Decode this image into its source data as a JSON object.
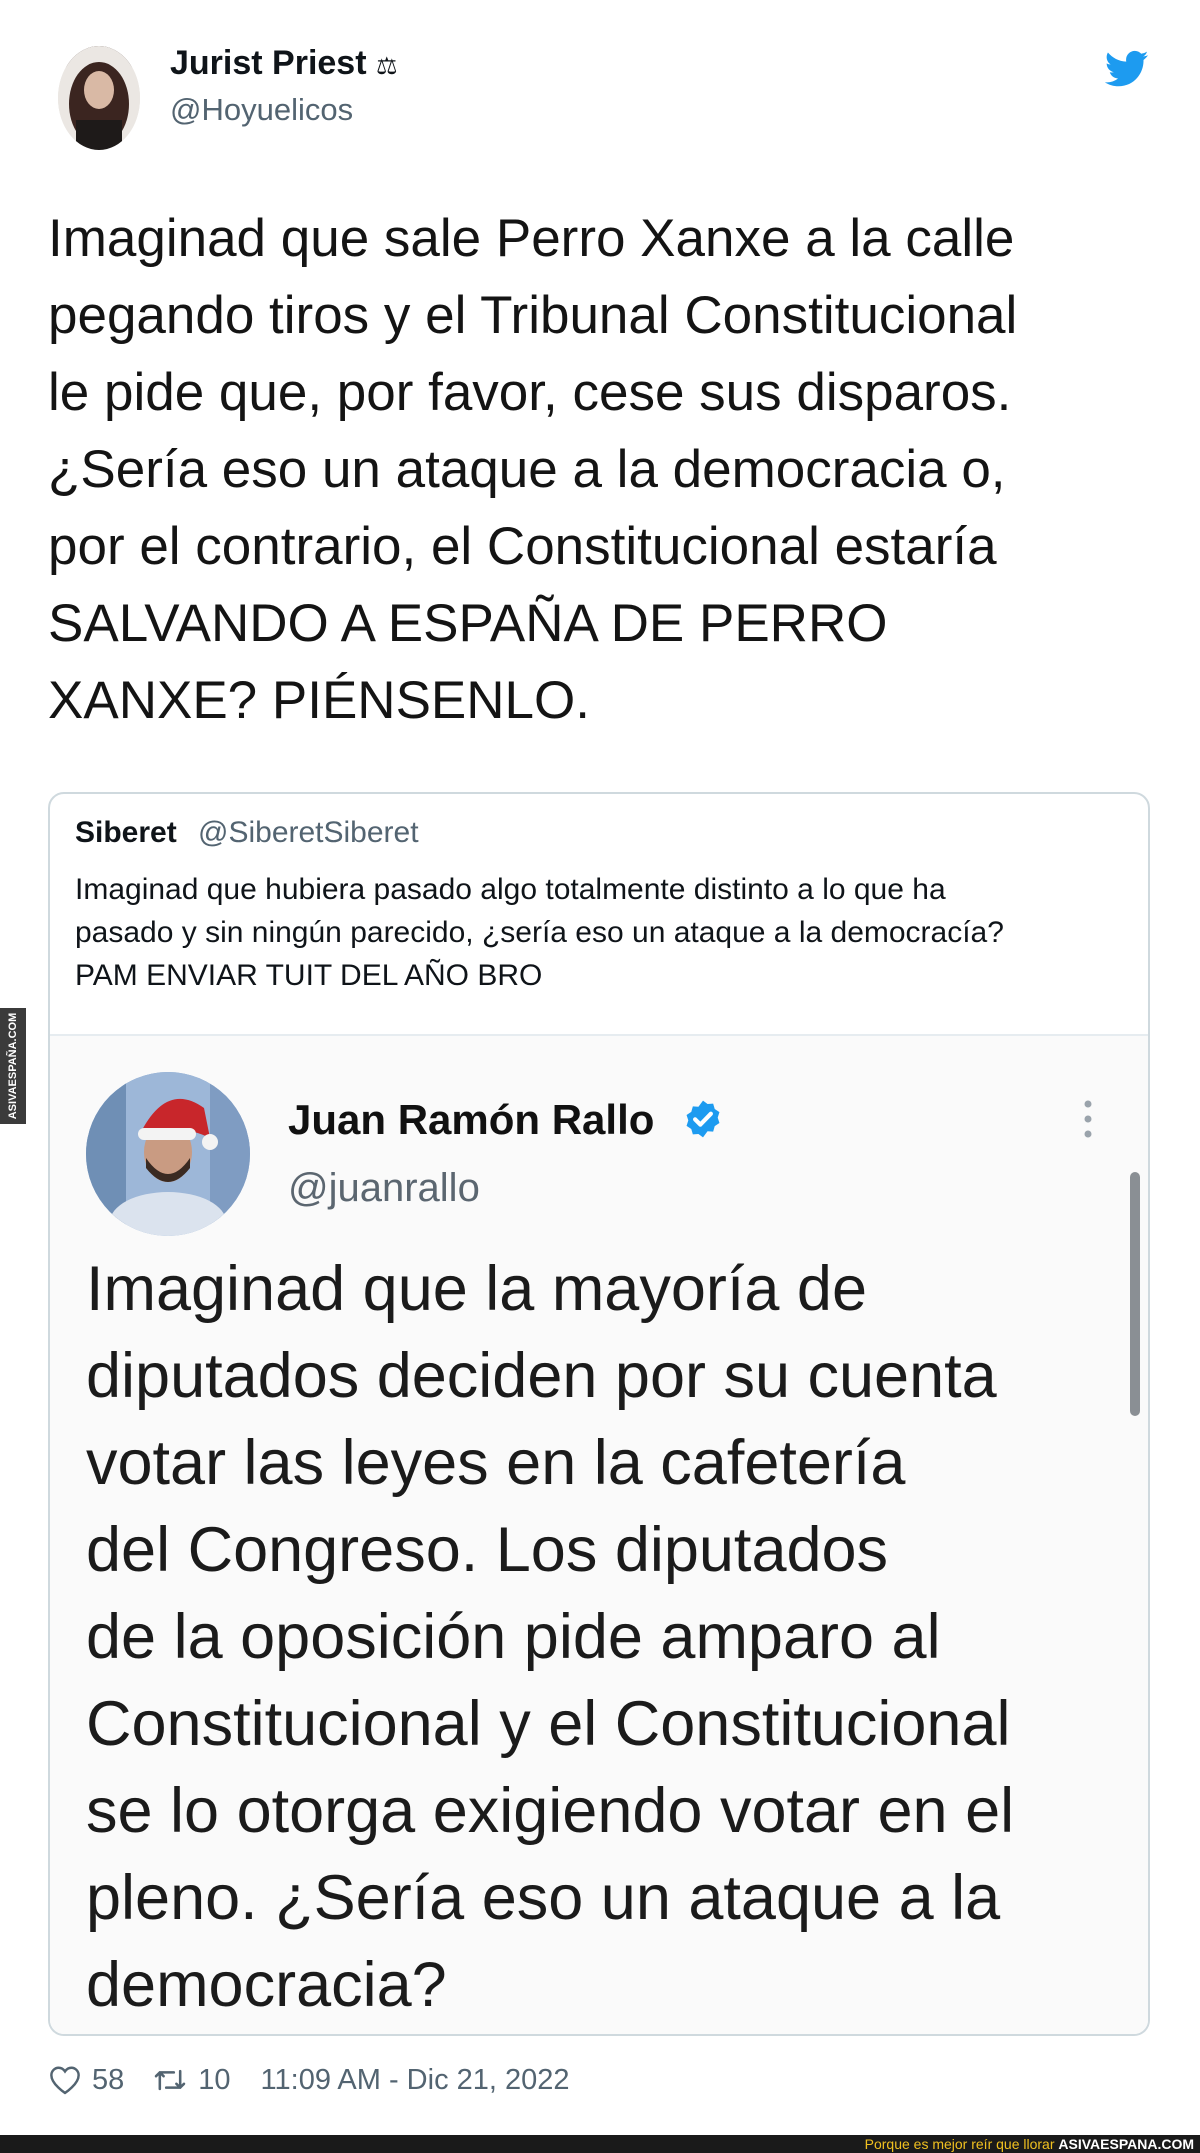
{
  "tweet": {
    "author_name": "Jurist Priest",
    "author_badge": "⚖",
    "author_handle": "@Hoyuelicos",
    "text": "Imaginad que sale Perro Xanxe a la calle\npegando tiros y el Tribunal Constitucional\nle pide que, por favor, cese sus disparos.\n¿Sería eso un ataque a la democracia o,\npor el contrario, el Constitucional estaría\nSALVANDO A ESPAÑA DE PERRO\nXANXE? PIÉNSENLO.",
    "brand_color": "#1d9bf0"
  },
  "quoted": {
    "author_name": "Siberet",
    "author_handle": "@SiberetSiberet",
    "text": "Imaginad que hubiera pasado algo totalmente distinto a lo que ha\npasado y sin ningún parecido, ¿sería eso un ataque a la democracía?\nPAM ENVIAR TUIT DEL AÑO BRO"
  },
  "embedded": {
    "author_name": "Juan Ramón Rallo",
    "author_handle": "@juanrallo",
    "text": "Imaginad que la mayoría de\ndiputados deciden por su cuenta\nvotar las leyes en la cafetería\ndel Congreso. Los diputados\nde la oposición pide  amparo al\nConstitucional y el Constitucional\nse lo otorga exigiendo votar en el\npleno. ¿Sería eso un ataque a la\ndemocracia?"
  },
  "footer": {
    "likes": "58",
    "retweets": "10",
    "timestamp": "11:09 AM - Dic 21, 2022"
  },
  "watermark": {
    "side_text": "ASIVAESPAÑA.COM",
    "slogan": "Porque es mejor reír que llorar",
    "site": "ASIVAESPANA.COM"
  },
  "icons": {
    "twitter": "twitter-bird-icon",
    "verified": "verified-badge-icon",
    "more": "more-vertical-icon",
    "like": "heart-icon",
    "retweet": "retweet-icon"
  }
}
